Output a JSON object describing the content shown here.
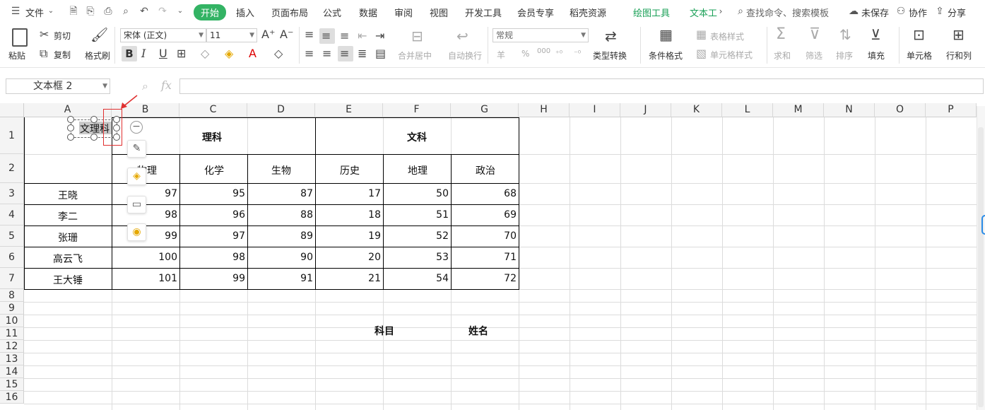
{
  "menu": {
    "file_label": "文件",
    "tabs": [
      "开始",
      "插入",
      "页面布局",
      "公式",
      "数据",
      "审阅",
      "视图",
      "开发工具",
      "会员专享",
      "稻壳资源"
    ],
    "context_tabs": [
      "绘图工具",
      "文本工"
    ],
    "search_placeholder": "查找命令、搜索模板",
    "unsaved": "未保存",
    "collab": "协作",
    "share": "分享"
  },
  "ribbon": {
    "paste": "粘贴",
    "cut": "剪切",
    "copy": "复制",
    "format_painter": "格式刷",
    "font_name": "宋体 (正文)",
    "font_size": "11",
    "bold": "B",
    "italic": "I",
    "underline": "U",
    "merge_center": "合并居中",
    "wrap": "自动换行",
    "number_format": "常规",
    "convert_type": "类型转换",
    "cond_format": "条件格式",
    "table_style": "表格样式",
    "cell_style": "单元格样式",
    "sum": "求和",
    "filter": "筛选",
    "sort": "排序",
    "fill": "填充",
    "cell": "单元格",
    "rowcol": "行和列",
    "currency": "羊",
    "percent": "%",
    "thousands": "000"
  },
  "formula_bar": {
    "name_box": "文本框 2",
    "fx": "fx",
    "value": ""
  },
  "grid": {
    "columns": [
      "A",
      "B",
      "C",
      "D",
      "E",
      "F",
      "G",
      "H",
      "I",
      "J",
      "K",
      "L",
      "M",
      "N",
      "O",
      "P"
    ],
    "rows": [
      "1",
      "2",
      "3",
      "4",
      "5",
      "6",
      "7",
      "8",
      "9",
      "10",
      "11",
      "12",
      "13",
      "14",
      "15",
      "16"
    ],
    "group_science": "理科",
    "group_arts": "文科",
    "textbox": "文理科",
    "subjects": [
      "物理",
      "化学",
      "生物",
      "历史",
      "地理",
      "政治"
    ],
    "students": [
      {
        "name": "王晓",
        "scores": [
          "97",
          "95",
          "87",
          "17",
          "50",
          "68"
        ]
      },
      {
        "name": "李二",
        "scores": [
          "98",
          "96",
          "88",
          "18",
          "51",
          "69"
        ]
      },
      {
        "name": "张珊",
        "scores": [
          "99",
          "97",
          "89",
          "19",
          "52",
          "70"
        ]
      },
      {
        "name": "高云飞",
        "scores": [
          "100",
          "98",
          "90",
          "20",
          "53",
          "71"
        ]
      },
      {
        "name": "王大锤",
        "scores": [
          "101",
          "99",
          "91",
          "21",
          "54",
          "72"
        ]
      }
    ],
    "label_subject": "科目",
    "label_name": "姓名"
  }
}
